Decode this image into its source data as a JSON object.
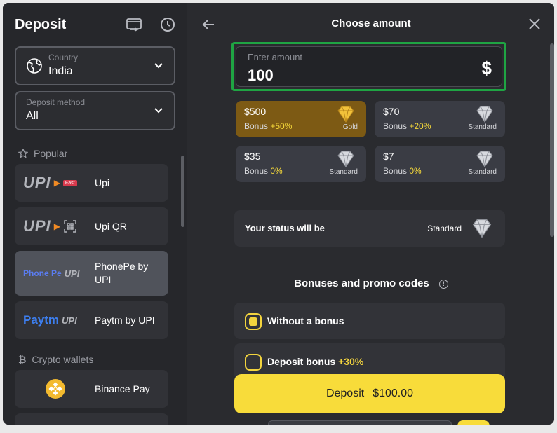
{
  "sidebar": {
    "title": "Deposit",
    "country": {
      "label": "Country",
      "value": "India"
    },
    "method": {
      "label": "Deposit method",
      "value": "All"
    },
    "popular_heading": "Popular",
    "methods": [
      {
        "name": "Upi",
        "logo": "UPI",
        "badge": "Fast"
      },
      {
        "name": "Upi QR",
        "logo": "UPI"
      },
      {
        "name": "PhonePe by UPI",
        "logo_a": "Phone Pe",
        "logo_b": "UPI"
      },
      {
        "name": "Paytm by UPI",
        "logo_a": "Paytm",
        "logo_b": "UPI"
      }
    ],
    "crypto_heading": "Crypto wallets",
    "crypto": [
      {
        "name": "Binance Pay"
      }
    ]
  },
  "main": {
    "title": "Choose amount",
    "amount": {
      "label": "Enter amount",
      "value": "100",
      "currency": "$"
    },
    "presets": [
      {
        "amount": "$500",
        "bonus_label": "Bonus",
        "bonus": "+50%",
        "tier": "Gold"
      },
      {
        "amount": "$70",
        "bonus_label": "Bonus",
        "bonus": "+20%",
        "tier": "Standard"
      },
      {
        "amount": "$35",
        "bonus_label": "Bonus",
        "bonus": "0%",
        "tier": "Standard"
      },
      {
        "amount": "$7",
        "bonus_label": "Bonus",
        "bonus": "0%",
        "tier": "Standard"
      }
    ],
    "status": {
      "label": "Your status will be",
      "value": "Standard"
    },
    "bonus_heading": "Bonuses and promo codes",
    "options": [
      {
        "label": "Without a bonus",
        "selected": true
      },
      {
        "label": "Deposit bonus",
        "extra": "+30%",
        "selected": false
      }
    ],
    "deposit_btn": {
      "label": "Deposit",
      "amount": "$100.00"
    }
  },
  "colors": {
    "accent": "#f8dc3a",
    "highlight": "#1fa443",
    "gold": "#7d5a14"
  }
}
